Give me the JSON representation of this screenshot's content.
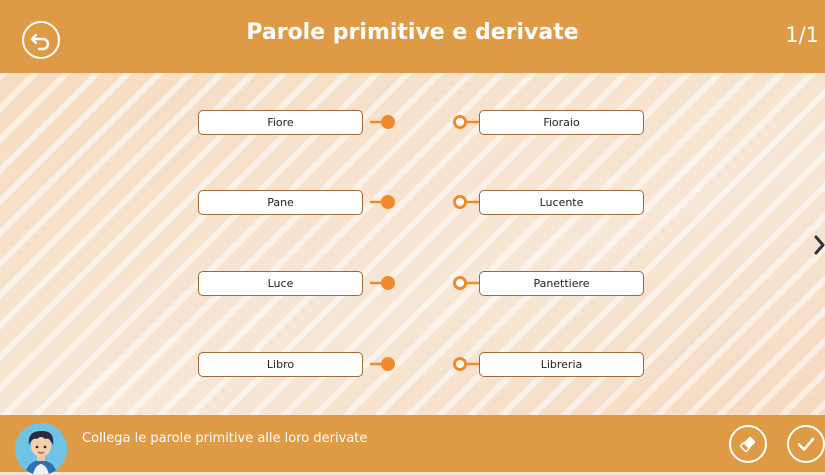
{
  "header": {
    "title": "Parole primitive e derivate",
    "page_counter": "1/1"
  },
  "left_words": [
    "Fiore",
    "Pane",
    "Luce",
    "Libro"
  ],
  "right_words": [
    "Fioraio",
    "Lucente",
    "Panettiere",
    "Libreria"
  ],
  "footer": {
    "instruction": "Collega le parole primitive alle loro derivate"
  },
  "colors": {
    "accent": "#de9a44",
    "connector": "#f08a2c",
    "background": "#f7e7d6"
  },
  "icons": {
    "back": "back-arrow-icon",
    "eraser": "eraser-icon",
    "check": "checkmark-icon",
    "next": "chevron-right-icon"
  }
}
